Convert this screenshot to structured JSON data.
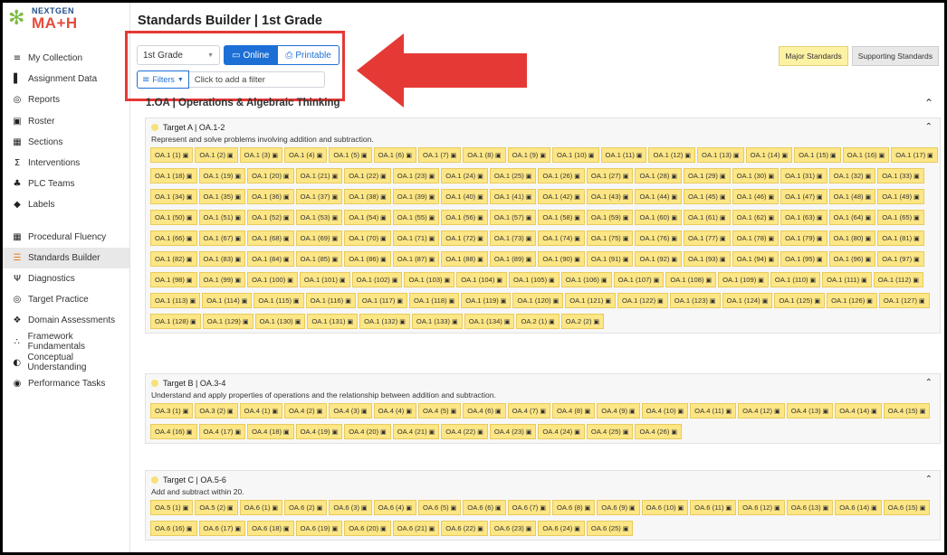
{
  "logo": {
    "line1": "NEXTGEN",
    "line2": "MA+H"
  },
  "sidebar": {
    "group1": [
      {
        "label": "My Collection",
        "icon": "book-icon",
        "glyph": "≡"
      },
      {
        "label": "Assignment Data",
        "icon": "bar-chart-icon",
        "glyph": "▌"
      },
      {
        "label": "Reports",
        "icon": "search-icon",
        "glyph": "◎"
      },
      {
        "label": "Roster",
        "icon": "roster-icon",
        "glyph": "▣"
      },
      {
        "label": "Sections",
        "icon": "sections-icon",
        "glyph": "▦"
      },
      {
        "label": "Interventions",
        "icon": "interventions-icon",
        "glyph": "Σ"
      },
      {
        "label": "PLC Teams",
        "icon": "team-icon",
        "glyph": "♣"
      },
      {
        "label": "Labels",
        "icon": "tag-icon",
        "glyph": "◆"
      }
    ],
    "group2": [
      {
        "label": "Procedural Fluency",
        "icon": "grid-icon",
        "glyph": "▦",
        "active": false
      },
      {
        "label": "Standards Builder",
        "icon": "list-icon",
        "glyph": "☰",
        "active": true
      },
      {
        "label": "Diagnostics",
        "icon": "diagnostics-icon",
        "glyph": "Ψ",
        "active": false
      },
      {
        "label": "Target Practice",
        "icon": "target-icon",
        "glyph": "◎",
        "active": false
      },
      {
        "label": "Domain Assessments",
        "icon": "domain-icon",
        "glyph": "❖",
        "active": false
      },
      {
        "label": "Framework Fundamentals",
        "icon": "sitemap-icon",
        "glyph": "∴",
        "active": false
      },
      {
        "label": "Conceptual Understanding",
        "icon": "compass-icon",
        "glyph": "◐",
        "active": false
      },
      {
        "label": "Performance Tasks",
        "icon": "globe-icon",
        "glyph": "◉",
        "active": false
      }
    ]
  },
  "header": {
    "title": "Standards Builder | 1st Grade"
  },
  "toolbar": {
    "grade": "1st Grade",
    "online_label": "Online",
    "printable_label": "Printable",
    "filters_label": "Filters",
    "filter_placeholder": "Click to add a filter",
    "major_label": "Major Standards",
    "supporting_label": "Supporting Standards"
  },
  "domain": {
    "title": "1.OA | Operations & Algebraic Thinking"
  },
  "targets": [
    {
      "title": "Target A | OA.1-2",
      "description": "Represent and solve problems involving addition and subtraction.",
      "chips": [
        "OA.1 (1)",
        "OA.1 (2)",
        "OA.1 (3)",
        "OA.1 (4)",
        "OA.1 (5)",
        "OA.1 (6)",
        "OA.1 (7)",
        "OA.1 (8)",
        "OA.1 (9)",
        "OA.1 (10)",
        "OA.1 (11)",
        "OA.1 (12)",
        "OA.1 (13)",
        "OA.1 (14)",
        "OA.1 (15)",
        "OA.1 (16)",
        "OA.1 (17)",
        "OA.1 (18)",
        "OA.1 (19)",
        "OA.1 (20)",
        "OA.1 (21)",
        "OA.1 (22)",
        "OA.1 (23)",
        "OA.1 (24)",
        "OA.1 (25)",
        "OA.1 (26)",
        "OA.1 (27)",
        "OA.1 (28)",
        "OA.1 (29)",
        "OA.1 (30)",
        "OA.1 (31)",
        "OA.1 (32)",
        "OA.1 (33)",
        "OA.1 (34)",
        "OA.1 (35)",
        "OA.1 (36)",
        "OA.1 (37)",
        "OA.1 (38)",
        "OA.1 (39)",
        "OA.1 (40)",
        "OA.1 (41)",
        "OA.1 (42)",
        "OA.1 (43)",
        "OA.1 (44)",
        "OA.1 (45)",
        "OA.1 (46)",
        "OA.1 (47)",
        "OA.1 (48)",
        "OA.1 (49)",
        "OA.1 (50)",
        "OA.1 (51)",
        "OA.1 (52)",
        "OA.1 (53)",
        "OA.1 (54)",
        "OA.1 (55)",
        "OA.1 (56)",
        "OA.1 (57)",
        "OA.1 (58)",
        "OA.1 (59)",
        "OA.1 (60)",
        "OA.1 (61)",
        "OA.1 (62)",
        "OA.1 (63)",
        "OA.1 (64)",
        "OA.1 (65)",
        "OA.1 (66)",
        "OA.1 (67)",
        "OA.1 (68)",
        "OA.1 (69)",
        "OA.1 (70)",
        "OA.1 (71)",
        "OA.1 (72)",
        "OA.1 (73)",
        "OA.1 (74)",
        "OA.1 (75)",
        "OA.1 (76)",
        "OA.1 (77)",
        "OA.1 (78)",
        "OA.1 (79)",
        "OA.1 (80)",
        "OA.1 (81)",
        "OA.1 (82)",
        "OA.1 (83)",
        "OA.1 (84)",
        "OA.1 (85)",
        "OA.1 (86)",
        "OA.1 (87)",
        "OA.1 (88)",
        "OA.1 (89)",
        "OA.1 (90)",
        "OA.1 (91)",
        "OA.1 (92)",
        "OA.1 (93)",
        "OA.1 (94)",
        "OA.1 (95)",
        "OA.1 (96)",
        "OA.1 (97)",
        "OA.1 (98)",
        "OA.1 (99)",
        "OA.1 (100)",
        "OA.1 (101)",
        "OA.1 (102)",
        "OA.1 (103)",
        "OA.1 (104)",
        "OA.1 (105)",
        "OA.1 (106)",
        "OA.1 (107)",
        "OA.1 (108)",
        "OA.1 (109)",
        "OA.1 (110)",
        "OA.1 (111)",
        "OA.1 (112)",
        "OA.1 (113)",
        "OA.1 (114)",
        "OA.1 (115)",
        "OA.1 (116)",
        "OA.1 (117)",
        "OA.1 (118)",
        "OA.1 (119)",
        "OA.1 (120)",
        "OA.1 (121)",
        "OA.1 (122)",
        "OA.1 (123)",
        "OA.1 (124)",
        "OA.1 (125)",
        "OA.1 (126)",
        "OA.1 (127)",
        "OA.1 (128)",
        "OA.1 (129)",
        "OA.1 (130)",
        "OA.1 (131)",
        "OA.1 (132)",
        "OA.1 (133)",
        "OA.1 (134)",
        "OA.2 (1)",
        "OA.2 (2)"
      ]
    },
    {
      "title": "Target B | OA.3-4",
      "description": "Understand and apply properties of operations and the relationship between addition and subtraction.",
      "chips": [
        "OA.3 (1)",
        "OA.3 (2)",
        "OA.4 (1)",
        "OA.4 (2)",
        "OA.4 (3)",
        "OA.4 (4)",
        "OA.4 (5)",
        "OA.4 (6)",
        "OA.4 (7)",
        "OA.4 (8)",
        "OA.4 (9)",
        "OA.4 (10)",
        "OA.4 (11)",
        "OA.4 (12)",
        "OA.4 (13)",
        "OA.4 (14)",
        "OA.4 (15)",
        "OA.4 (16)",
        "OA.4 (17)",
        "OA.4 (18)",
        "OA.4 (19)",
        "OA.4 (20)",
        "OA.4 (21)",
        "OA.4 (22)",
        "OA.4 (23)",
        "OA.4 (24)",
        "OA.4 (25)",
        "OA.4 (26)"
      ]
    },
    {
      "title": "Target C | OA.5-6",
      "description": "Add and subtract within 20.",
      "chips": [
        "OA.5 (1)",
        "OA.5 (2)",
        "OA.6 (1)",
        "OA.6 (2)",
        "OA.6 (3)",
        "OA.6 (4)",
        "OA.6 (5)",
        "OA.6 (6)",
        "OA.6 (7)",
        "OA.6 (8)",
        "OA.6 (9)",
        "OA.6 (10)",
        "OA.6 (11)",
        "OA.6 (12)",
        "OA.6 (13)",
        "OA.6 (14)",
        "OA.6 (15)",
        "OA.6 (16)",
        "OA.6 (17)",
        "OA.6 (18)",
        "OA.6 (19)",
        "OA.6 (20)",
        "OA.6 (21)",
        "OA.6 (22)",
        "OA.6 (23)",
        "OA.6 (24)",
        "OA.6 (25)"
      ]
    }
  ],
  "colors": {
    "accent": "#1d6fd6",
    "chip": "#fde685",
    "highlight": "#e53935"
  }
}
